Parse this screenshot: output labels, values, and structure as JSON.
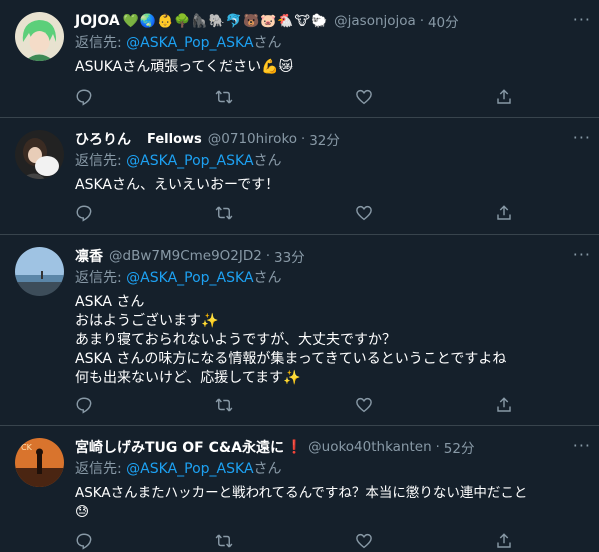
{
  "reply_prefix": "返信先:",
  "reply_suffix": "さん",
  "more_label": "···",
  "dot": "·",
  "tweets": [
    {
      "name": "JOJOA",
      "name_emojis": "💚🌏👶🌳🦍🐘🐬🐻🐷🐔🐮🐑",
      "handle": "@jasonjojoa",
      "time": "40分",
      "reply_to": "@ASKA_Pop_ASKA",
      "body": [
        "ASUKAさん頑張ってください💪😿"
      ],
      "avatar_color": "#7fd38a"
    },
    {
      "name": "ひろりん",
      "name_badge": "Fellows",
      "handle": "@0710hiroko",
      "time": "32分",
      "reply_to": "@ASKA_Pop_ASKA",
      "body": [
        "ASKAさん、えいえいおーです！"
      ],
      "avatar_color": "#2a2a2a"
    },
    {
      "name": "凛香",
      "handle": "@dBw7M9Cme9O2JD2",
      "time": "33分",
      "reply_to": "@ASKA_Pop_ASKA",
      "body": [
        "ASKA さん",
        "おはようございます✨",
        "あまり寝ておられないようですが、大丈夫ですか？",
        "ASKA さんの味方になる情報が集まってきているということですよね",
        "何も出来ないけど、応援してます✨"
      ],
      "avatar_color": "#8fb6d8"
    },
    {
      "name": "宮崎しげみTUG OF C&A永遠に",
      "name_badge": "❗",
      "handle": "@uoko40thkanten",
      "time": "52分",
      "reply_to": "@ASKA_Pop_ASKA",
      "body": [
        "ASKAさんまたハッカーと戦われてるんですね？本当に懲りない連中だこと",
        "😓"
      ],
      "avatar_color": "#b6521f"
    }
  ]
}
